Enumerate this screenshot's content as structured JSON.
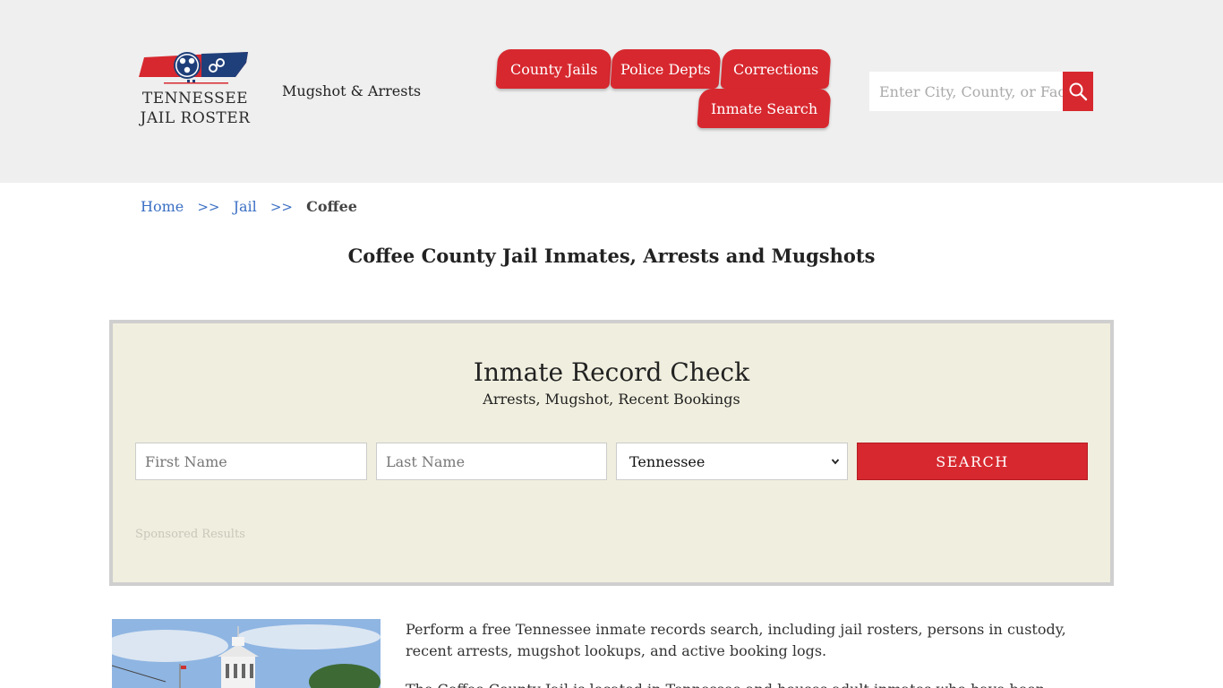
{
  "header": {
    "logo": {
      "line1": "TENNESSEE",
      "line2": "JAIL ROSTER",
      "colors": {
        "red": "#d7282f",
        "blue": "#1f3f7a"
      }
    },
    "tagline": "Mugshot & Arrests",
    "nav": {
      "county_jails": "County Jails",
      "police_depts": "Police Depts",
      "corrections": "Corrections",
      "inmate_search": "Inmate Search"
    },
    "search": {
      "placeholder": "Enter City, County, or Facility",
      "icon": "search-icon"
    }
  },
  "breadcrumb": {
    "home": "Home",
    "sep": ">>",
    "jail": "Jail",
    "current": "Coffee"
  },
  "page_title": "Coffee County Jail Inmates, Arrests and Mugshots",
  "record_check": {
    "title": "Inmate Record Check",
    "subtitle": "Arrests, Mugshot, Recent Bookings",
    "first_name_placeholder": "First Name",
    "last_name_placeholder": "Last Name",
    "state_selected": "Tennessee",
    "search_label": "SEARCH",
    "sponsored": "Sponsored Results"
  },
  "content": {
    "paragraph1": "Perform a free Tennessee inmate records search, including jail rosters, persons in custody, recent arrests, mugshot lookups, and active booking logs.",
    "paragraph2": "The Coffee County Jail is located in Tennessee and houses adult inmates who have been charged with"
  },
  "colors": {
    "accent": "#d7282f",
    "link": "#3a6fc4",
    "panel_bg": "#f0eede",
    "header_bg": "#efefef"
  }
}
